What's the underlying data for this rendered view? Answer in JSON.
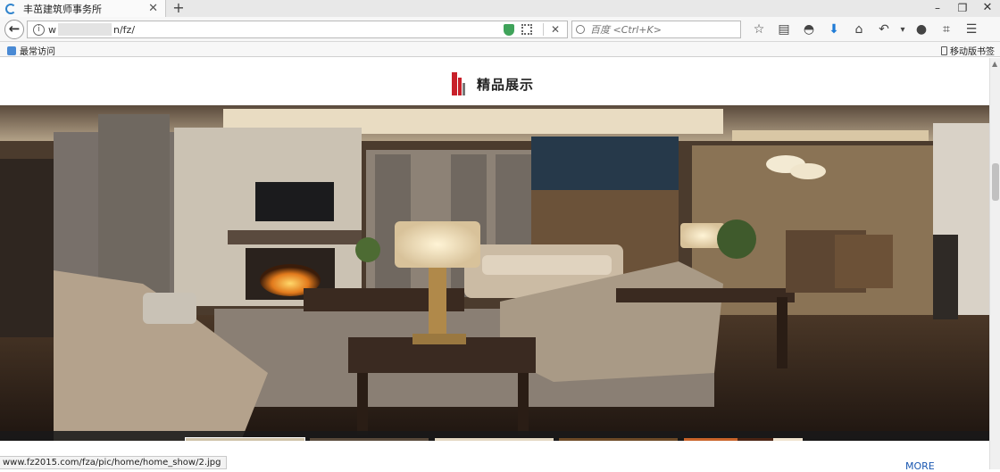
{
  "browser": {
    "tab_title": "丰茁建筑师事务所",
    "tab_close": "✕",
    "new_tab": "+",
    "url_prefix": "w",
    "url_suffix": "n/fz/",
    "url_clear": "✕",
    "search_placeholder": "百度 <Ctrl+K>",
    "bookmarks_left": "最常访问",
    "bookmarks_right": "移动版书签",
    "window": {
      "minimize": "–",
      "restore": "❐",
      "close": "✕"
    },
    "toolbar_icons": [
      "star-icon",
      "reading-list-icon",
      "pocket-icon",
      "download-icon",
      "home-icon",
      "undo-icon",
      "dropdown-icon",
      "chat-icon",
      "screenshot-icon",
      "menu-icon"
    ]
  },
  "page": {
    "section_title": "精品展示",
    "more_link": "MORE",
    "status_url": "www.fz2015.com/fza/pic/home/home_show/2.jpg",
    "gallery": {
      "active_index": 0,
      "thumbnail_count": 5
    }
  }
}
